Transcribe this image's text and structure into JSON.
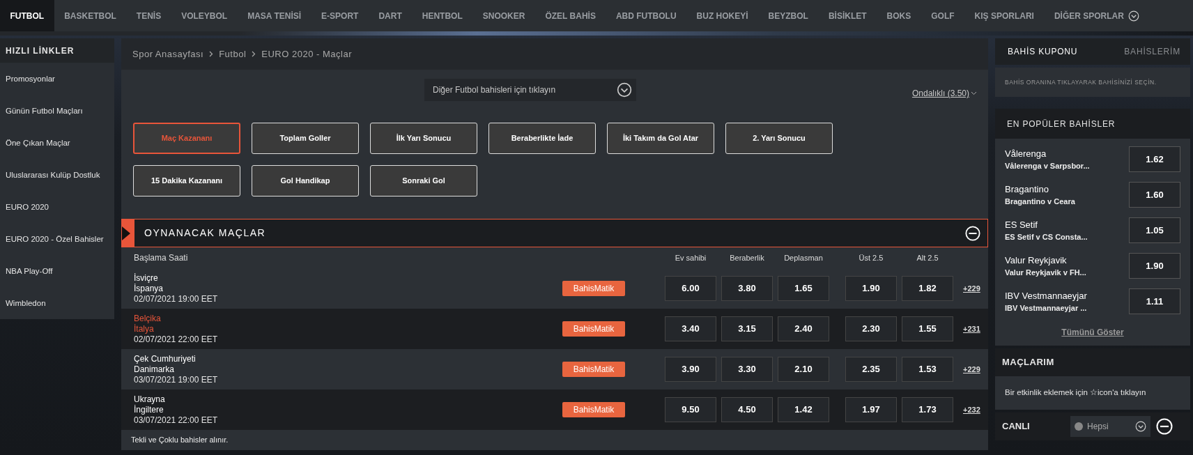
{
  "sport_tabs": [
    {
      "label": "FUTBOL",
      "selected": true
    },
    {
      "label": "BASKETBOL",
      "selected": false
    },
    {
      "label": "TENİS",
      "selected": false
    },
    {
      "label": "VOLEYBOL",
      "selected": false
    },
    {
      "label": "MASA TENİSİ",
      "selected": false
    },
    {
      "label": "E-SPORT",
      "selected": false
    },
    {
      "label": "DART",
      "selected": false
    },
    {
      "label": "HENTBOL",
      "selected": false
    },
    {
      "label": "SNOOKER",
      "selected": false
    },
    {
      "label": "ÖZEL BAHİS",
      "selected": false
    },
    {
      "label": "ABD FUTBOLU",
      "selected": false
    },
    {
      "label": "BUZ HOKEYİ",
      "selected": false
    },
    {
      "label": "BEYZBOL",
      "selected": false
    },
    {
      "label": "BİSİKLET",
      "selected": false
    },
    {
      "label": "BOKS",
      "selected": false
    },
    {
      "label": "GOLF",
      "selected": false
    },
    {
      "label": "KIŞ SPORLARI",
      "selected": false
    },
    {
      "label": "DİĞER SPORLAR",
      "selected": false
    }
  ],
  "sidebar": {
    "title": "HIZLI LİNKLER",
    "items": [
      "Promosyonlar",
      "Günün Futbol Maçları",
      "Öne Çıkan Maçlar",
      "Uluslararası Kulüp Dostluk",
      "EURO 2020",
      "EURO 2020 - Özel Bahisler",
      "NBA Play-Off",
      "Wimbledon"
    ]
  },
  "breadcrumb": [
    "Spor Anasayfası",
    "Futbol",
    "EURO 2020 - Maçlar"
  ],
  "more_bets_dropdown": "Diğer Futbol bahisleri için tıklayın",
  "odds_format": "Ondalıklı (3.50)",
  "markets": [
    {
      "label": "Maç Kazananı",
      "selected": true
    },
    {
      "label": "Toplam Goller",
      "selected": false
    },
    {
      "label": "İlk Yarı Sonucu",
      "selected": false
    },
    {
      "label": "Beraberlikte İade",
      "selected": false
    },
    {
      "label": "İki Takım da Gol Atar",
      "selected": false
    },
    {
      "label": "2. Yarı Sonucu",
      "selected": false
    },
    {
      "label": "15 Dakika Kazananı",
      "selected": false
    },
    {
      "label": "Gol Handikap",
      "selected": false
    },
    {
      "label": "Sonraki Gol",
      "selected": false
    }
  ],
  "matches": {
    "title": "OYNANACAK MAÇLAR",
    "columns": [
      "Başlama Saati",
      "Ev sahibi",
      "Beraberlik",
      "Deplasman",
      "Üst 2.5",
      "Alt 2.5"
    ],
    "rows": [
      {
        "home": "İsviçre",
        "away": "İspanya",
        "time": "02/07/2021 19:00 EET",
        "highlighted": false,
        "action": "BahisMatik",
        "odds": [
          "6.00",
          "3.80",
          "1.65"
        ],
        "totals": [
          "1.90",
          "1.82"
        ],
        "more": "+229"
      },
      {
        "home": "Belçika",
        "away": "İtalya",
        "time": "02/07/2021 22:00 EET",
        "highlighted": true,
        "action": "BahisMatik",
        "odds": [
          "3.40",
          "3.15",
          "2.40"
        ],
        "totals": [
          "2.30",
          "1.55"
        ],
        "more": "+231"
      },
      {
        "home": "Çek Cumhuriyeti",
        "away": "Danimarka",
        "time": "03/07/2021 19:00 EET",
        "highlighted": false,
        "action": "BahisMatik",
        "odds": [
          "3.90",
          "3.30",
          "2.10"
        ],
        "totals": [
          "2.35",
          "1.53"
        ],
        "more": "+229"
      },
      {
        "home": "Ukrayna",
        "away": "İngiltere",
        "time": "03/07/2021 22:00 EET",
        "highlighted": false,
        "action": "BahisMatik",
        "odds": [
          "9.50",
          "4.50",
          "1.42"
        ],
        "totals": [
          "1.97",
          "1.73"
        ],
        "more": "+232"
      }
    ],
    "footnote": "Tekli ve Çoklu bahisler alınır."
  },
  "coupon": {
    "tabs": [
      {
        "label": "BAHİS KUPONU",
        "selected": true
      },
      {
        "label": "BAHİSLERİM",
        "selected": false
      }
    ],
    "message": "BAHİS ORANINA TIKLAYARAK BAHİSİNİZİ SEÇİN."
  },
  "popular": {
    "title": "EN POPÜLER BAHİSLER",
    "items": [
      {
        "selection": "Vålerenga",
        "event": "Vålerenga v Sarpsbor...",
        "odds": "1.62"
      },
      {
        "selection": "Bragantino",
        "event": "Bragantino v Ceara",
        "odds": "1.60"
      },
      {
        "selection": "ES Setif",
        "event": "ES Setif v CS Consta...",
        "odds": "1.05"
      },
      {
        "selection": "Valur Reykjavik",
        "event": "Valur Reykjavik v FH...",
        "odds": "1.90"
      },
      {
        "selection": "IBV Vestmannaeyjar",
        "event": "IBV Vestmannaeyjar ...",
        "odds": "1.11"
      }
    ],
    "show_all": "Tümünü Göster"
  },
  "my_matches": {
    "title": "MAÇLARIM",
    "hint": "Bir etkinlik eklemek için ☆icon'a tıklayın"
  },
  "live": {
    "title": "CANLI",
    "filter": "Hepsi"
  }
}
